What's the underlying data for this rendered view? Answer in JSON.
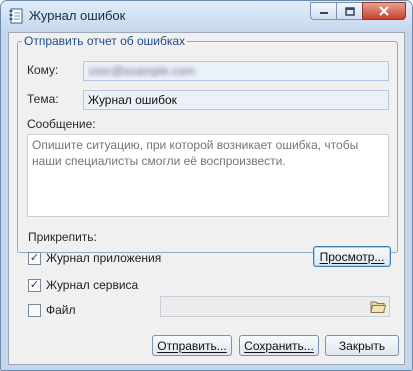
{
  "window": {
    "title": "Журнал ошибок"
  },
  "group": {
    "title": "Отправить отчет об ошибках"
  },
  "form": {
    "to_label": "Кому:",
    "to_value": "user@example.com",
    "subject_label": "Тема:",
    "subject_value": "Журнал ошибок",
    "message_label": "Сообщение:",
    "message_placeholder": "Опишите ситуацию, при которой возникает ошибка, чтобы наши специалисты смогли её воспроизвести."
  },
  "attach": {
    "label": "Прикрепить:",
    "app_log_label": "Журнал приложения",
    "app_log_checked": true,
    "service_log_label": "Журнал сервиса",
    "service_log_checked": true,
    "file_label": "Файл",
    "file_checked": false,
    "file_value": "",
    "preview_button": "Просмотр..."
  },
  "buttons": {
    "send": "Отправить...",
    "save": "Сохранить...",
    "close": "Закрыть"
  },
  "icons": {
    "app": "journal-icon",
    "minimize": "minimize-icon",
    "maximize": "maximize-icon",
    "close": "close-icon",
    "folder": "open-folder-icon"
  }
}
